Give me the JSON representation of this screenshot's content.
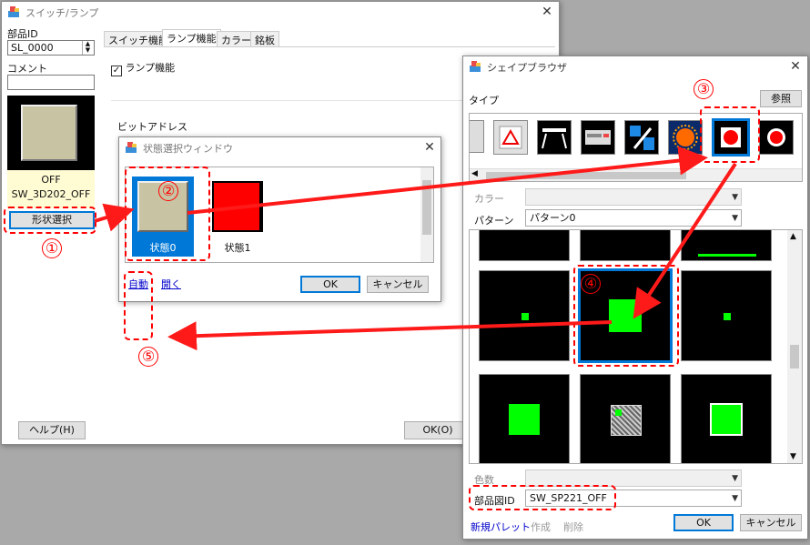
{
  "main_window": {
    "title": "スイッチ/ランプ",
    "part_id_label": "部品ID",
    "part_id_value": "SL_0000",
    "comment_label": "コメント",
    "comment_value": "",
    "preview_text1": "OFF",
    "preview_text2": "SW_3D202_OFF",
    "shape_select_button": "形状選択",
    "tabs": [
      "スイッチ機能",
      "ランプ機能",
      "カラー",
      "銘板"
    ],
    "lamp_function_checkbox": "ランプ機能",
    "bit_address_label": "ビットアドレス",
    "help_button": "ヘルプ(H)",
    "ok_button": "OK(O)"
  },
  "state_window": {
    "title": "状態選択ウィンドウ",
    "state0_label": "状態0",
    "state1_label": "状態1",
    "auto_link": "自動",
    "open_link": "開く",
    "ok_button": "OK",
    "cancel_button": "キャンセル"
  },
  "shape_browser": {
    "title": "シェイプブラウザ",
    "type_label": "タイプ",
    "reference_button": "参照",
    "color_label": "カラー",
    "pattern_label": "パターン",
    "pattern_value": "パターン0",
    "color_count_label": "色数",
    "part_figure_id_label": "部品図ID",
    "part_figure_id_value": "SW_SP221_OFF",
    "new_palette_link": "新規パレット",
    "create_link": "作成",
    "delete_link": "削除",
    "ok_button": "OK",
    "cancel_button": "キャンセル"
  },
  "annotations": {
    "n1": "①",
    "n2": "②",
    "n3": "③",
    "n4": "④",
    "n5": "⑤"
  },
  "colors": {
    "annotation_red": "#ff0000",
    "lamp_green": "#00ff00",
    "state1_red": "#ff0000",
    "selection_blue": "#0078d7",
    "beige": "#c8c3a3"
  }
}
